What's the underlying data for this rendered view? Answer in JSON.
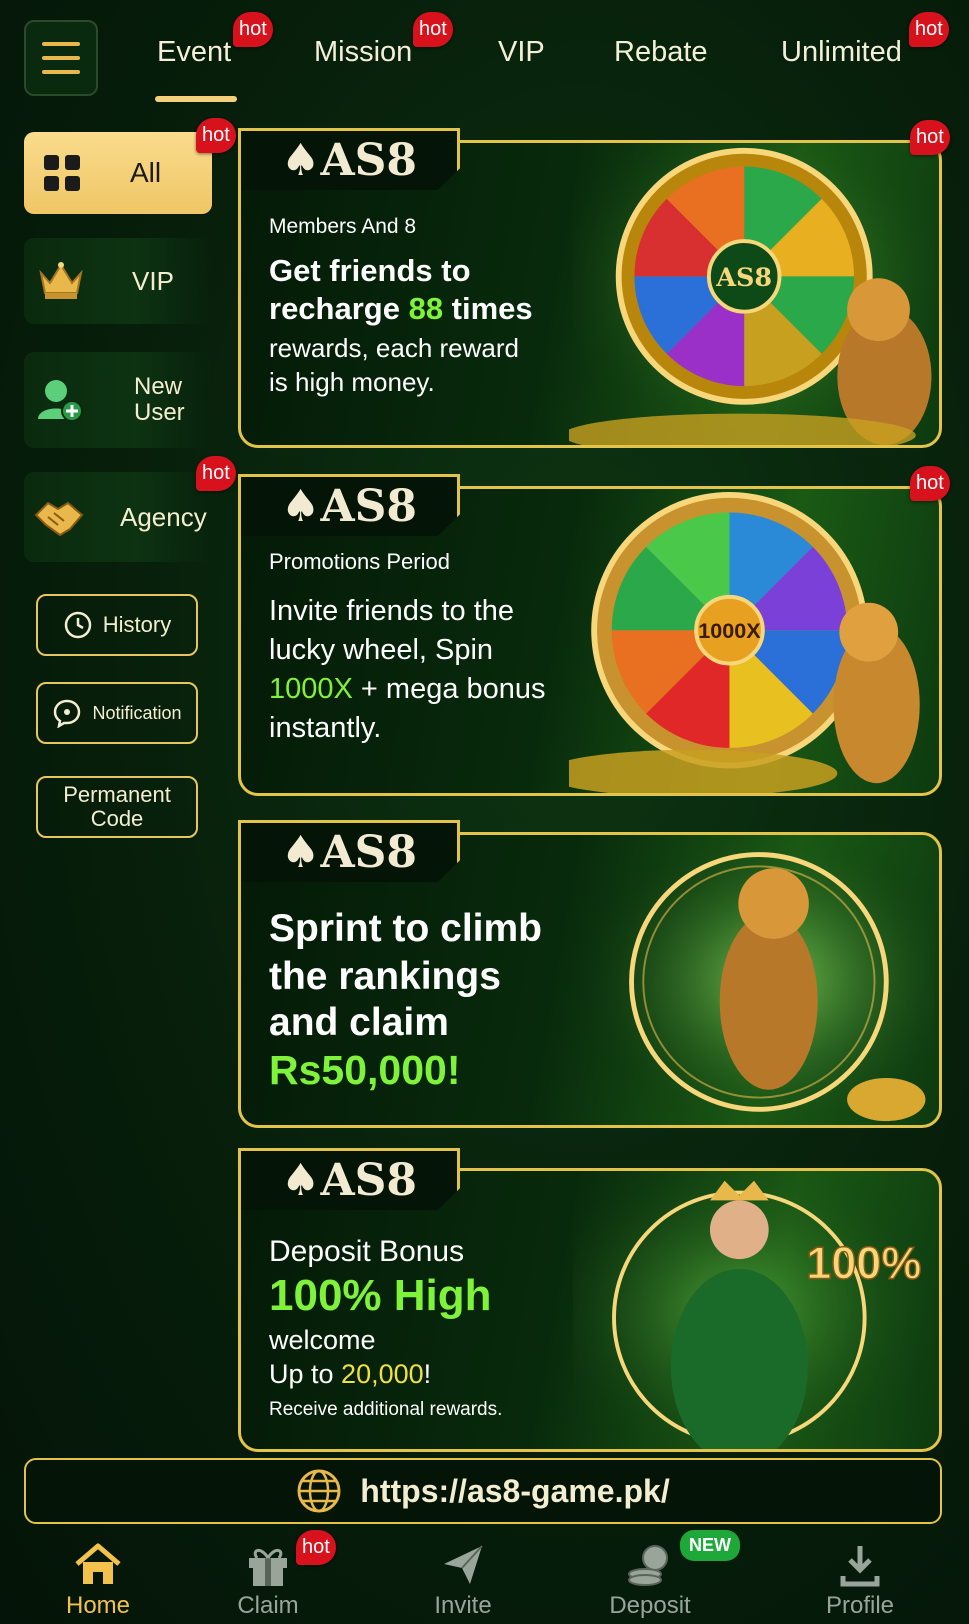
{
  "top_tabs": [
    {
      "label": "Event",
      "hot": "hot"
    },
    {
      "label": "Mission",
      "hot": "hot"
    },
    {
      "label": "VIP"
    },
    {
      "label": "Rebate"
    },
    {
      "label": "Unlimited",
      "hot": "hot"
    }
  ],
  "sidebar": {
    "items": [
      {
        "label": "All",
        "hot": "hot"
      },
      {
        "label": "VIP"
      },
      {
        "label": "New User"
      },
      {
        "label": "Agency",
        "hot": "hot"
      }
    ],
    "buttons": [
      {
        "label": "History"
      },
      {
        "label": "Notification"
      },
      {
        "label": "Permanent Code"
      }
    ]
  },
  "banners": [
    {
      "logo": "AS8",
      "subtitle": "Members And 8",
      "line1": "Get friends to",
      "line2_a": "recharge ",
      "line2_b": "88",
      "line2_c": " times",
      "line3": "rewards, each reward",
      "line4": "is high money.",
      "hot": "hot",
      "wheel_center": "AS8"
    },
    {
      "logo": "AS8",
      "subtitle": "Promotions Period",
      "line1": "Invite friends to the",
      "line2": "lucky wheel, Spin",
      "line3_a": "1000X",
      "line3_b": " + mega bonus",
      "line4": "instantly.",
      "hot": "hot",
      "wheel_center": "1000X"
    },
    {
      "logo": "AS8",
      "line1": "Sprint to climb",
      "line2": "the rankings",
      "line3": "and claim",
      "line4": "Rs50,000!"
    },
    {
      "logo": "AS8",
      "line1": "Deposit Bonus",
      "line2": "100% High",
      "line3": "welcome",
      "line4_a": "Up to ",
      "line4_b": "20,000",
      "line4_c": "!",
      "line5": "Receive additional rewards.",
      "art_text": "100%"
    }
  ],
  "url_bar": {
    "url": "https://as8-game.pk/"
  },
  "bottom_nav": [
    {
      "label": "Home",
      "icon": "home-icon"
    },
    {
      "label": "Claim",
      "icon": "gift-icon",
      "hot": "hot"
    },
    {
      "label": "Invite",
      "icon": "paper-plane-icon"
    },
    {
      "label": "Deposit",
      "icon": "coins-icon",
      "badge": "NEW"
    },
    {
      "label": "Profile",
      "icon": "download-icon"
    }
  ],
  "colors": {
    "accent": "#f2c24c",
    "highlight_green": "#7ff23a",
    "border_gold": "#e3c349",
    "hot_red": "#d8121c"
  }
}
